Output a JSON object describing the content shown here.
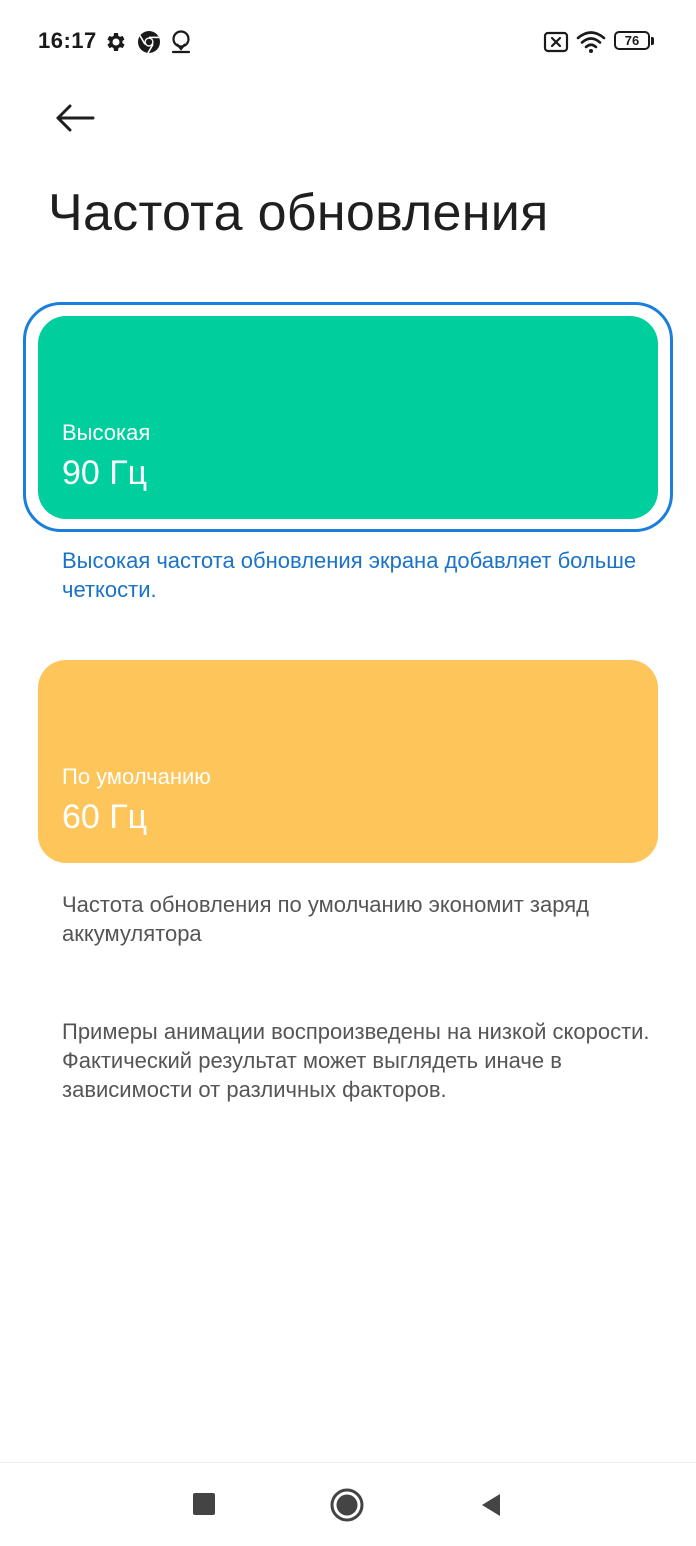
{
  "status_bar": {
    "time": "16:17",
    "icons": [
      "gear-icon",
      "chrome-icon",
      "location-icon",
      "no-sim-icon",
      "wifi-icon",
      "battery-icon"
    ],
    "battery_level": "76",
    "battery_fraction": 0.76
  },
  "header": {
    "back_icon": "arrow-left-icon",
    "title": "Частота обновления"
  },
  "options": [
    {
      "label": "Высокая",
      "value": "90 Гц",
      "description": "Высокая частота обновления экрана добавляет больше четкости.",
      "selected": true,
      "color": "#00cf9d",
      "description_color": "#1a73c6"
    },
    {
      "label": "По умолчанию",
      "value": "60 Гц",
      "description": "Частота обновления по умолчанию экономит заряд аккумулятора",
      "selected": false,
      "color": "#fdc55a",
      "description_color": "#555555"
    }
  ],
  "note": "Примеры анимации воспроизведены на низкой скорости. Фактический результат может выглядеть иначе в зависимости от различных факторов.",
  "colors": {
    "selection_border": "#1a7fdc",
    "background": "#ffffff"
  },
  "nav_bar": {
    "icons": [
      "recents-icon",
      "home-icon",
      "back-triangle-icon"
    ]
  }
}
